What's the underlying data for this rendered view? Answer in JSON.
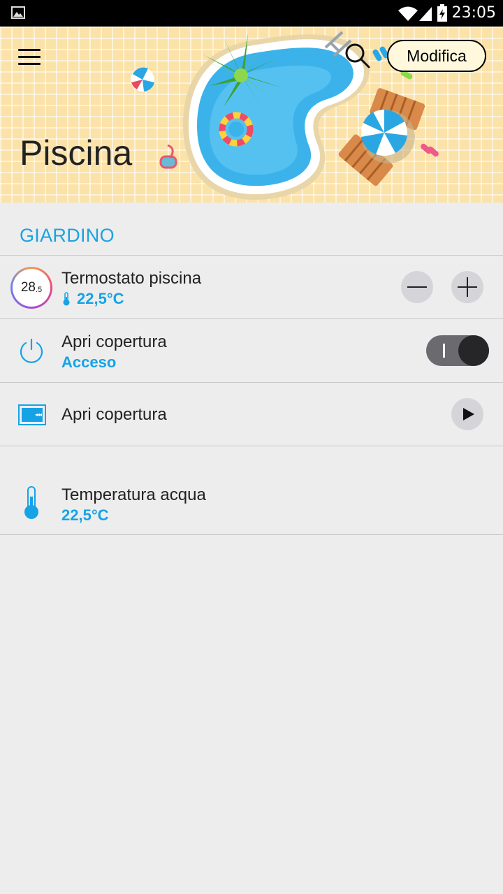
{
  "status_bar": {
    "time": "23:05",
    "icons": [
      "gallery-icon",
      "wifi-icon",
      "signal-icon",
      "battery-charging-icon"
    ]
  },
  "header": {
    "title": "Piscina",
    "edit_label": "Modifica",
    "icons": [
      "menu-icon",
      "search-icon"
    ]
  },
  "section": {
    "title": "GIARDINO",
    "items": [
      {
        "type": "thermostat",
        "dial_value": "28",
        "dial_decimal": ".5",
        "name": "Termostato piscina",
        "value": "22,5°C",
        "icons": [
          "thermometer-small-icon",
          "minus-icon",
          "plus-icon"
        ]
      },
      {
        "type": "switch",
        "name": "Apri copertura",
        "status": "Acceso",
        "switch_on": true,
        "icons": [
          "power-icon"
        ]
      },
      {
        "type": "scenario",
        "name": "Apri copertura",
        "icons": [
          "cover-icon",
          "play-icon"
        ]
      },
      {
        "type": "sensor",
        "name": "Temperatura acqua",
        "value": "22,5°C",
        "icons": [
          "thermometer-icon"
        ]
      }
    ]
  },
  "colors": {
    "accent": "#15a3e6",
    "background": "#ededee",
    "header_tiles": "#fbe2a9"
  }
}
